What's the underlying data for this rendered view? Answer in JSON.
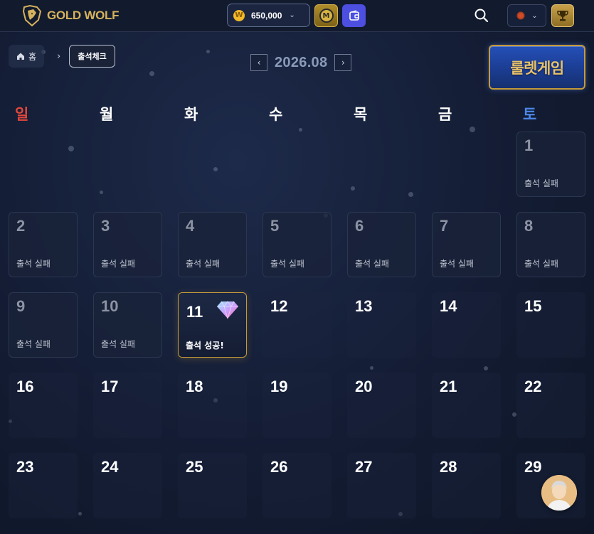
{
  "header": {
    "brand": "GOLD WOLF",
    "balance": "650,000",
    "coin_symbol": "W",
    "m_symbol": "M"
  },
  "breadcrumb": {
    "home": "홈",
    "current": "출석체크"
  },
  "calendar": {
    "month": "2026.08",
    "weekdays": [
      "일",
      "월",
      "화",
      "수",
      "목",
      "금",
      "토"
    ],
    "fail_label": "출석 실패",
    "success_label": "출석 성공!",
    "days": [
      "1",
      "2",
      "3",
      "4",
      "5",
      "6",
      "7",
      "8",
      "9",
      "10",
      "11",
      "12",
      "13",
      "14",
      "15",
      "16",
      "17",
      "18",
      "19",
      "20",
      "21",
      "22",
      "23",
      "24",
      "25",
      "26",
      "27",
      "28",
      "29"
    ],
    "success_day": "11"
  },
  "roulette_button": "룰렛게임",
  "colors": {
    "gold": "#d6b25e",
    "sunday": "#e1473a",
    "saturday": "#4c87e8",
    "wallet": "#4c4fe0"
  }
}
